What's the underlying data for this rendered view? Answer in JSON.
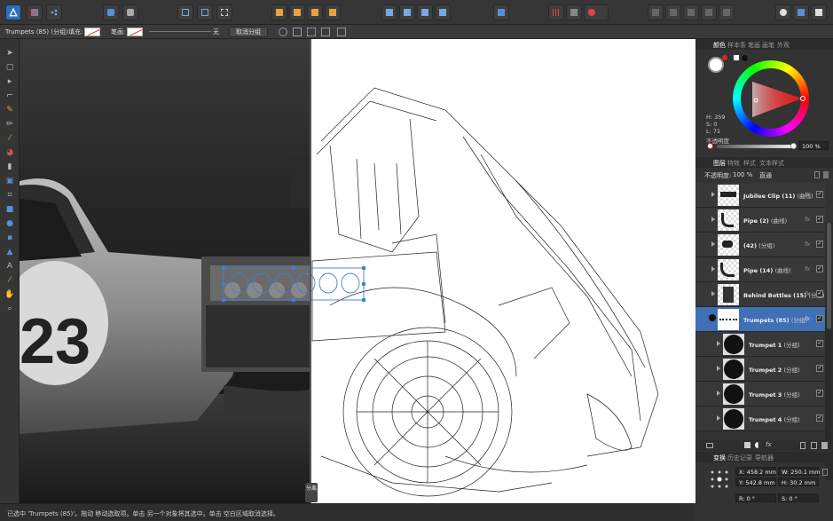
{
  "context_bar": {
    "selection": "Trumpets (85) (分组)",
    "fill_label": "填充:",
    "stroke_label": "笔画:",
    "stroke_width": "无",
    "ungroup_button": "取消分组"
  },
  "canvas": {
    "split_label": "分离",
    "car_number": "23"
  },
  "status": {
    "text": "已选中 'Trumpets (85)'。拖动 移动选取项。单击 另一个对象将其选中。单击 空白区域取消选择。"
  },
  "color_panel": {
    "tabs": [
      "颜色",
      "样本条",
      "笔画",
      "画笔",
      "外观"
    ],
    "active_tab": "颜色",
    "h": "H: 359",
    "s": "S: 0",
    "l": "L: 71",
    "opacity_label": "不透明度",
    "opacity_value": "100 %"
  },
  "layers_panel": {
    "tabs": [
      "图层",
      "特效",
      "样式",
      "文本样式"
    ],
    "active_tab": "图层",
    "opacity_label": "不透明度:",
    "opacity_value": "100 %",
    "blend_mode": "直通",
    "layers": [
      {
        "name": "Jubilee Clip (11)",
        "type": "(曲线)",
        "fx": "fx",
        "checked": "✓",
        "indent": 0
      },
      {
        "name": "Pipe (2)",
        "type": "(曲线)",
        "fx": "fx",
        "checked": "✓",
        "indent": 0
      },
      {
        "name": "(42)",
        "type": "(分组)",
        "fx": "fx",
        "checked": "✓",
        "indent": 0
      },
      {
        "name": "Pipe (14)",
        "type": "(曲线)",
        "fx": "fx",
        "checked": "✓",
        "indent": 0
      },
      {
        "name": "Behind Bottles (15)",
        "type": "(分组)",
        "fx": "fx",
        "checked": "✓",
        "indent": 0
      },
      {
        "name": "Trumpets (85)",
        "type": "(分组)",
        "fx": "fx",
        "checked": "✓",
        "indent": 0,
        "selected": true
      },
      {
        "name": "Trumpet 1",
        "type": "(分组)",
        "fx": "",
        "checked": "✓",
        "indent": 1
      },
      {
        "name": "Trumpet 2",
        "type": "(分组)",
        "fx": "",
        "checked": "✓",
        "indent": 1
      },
      {
        "name": "Trumpet 3",
        "type": "(分组)",
        "fx": "",
        "checked": "✓",
        "indent": 1
      },
      {
        "name": "Trumpet 4",
        "type": "(分组)",
        "fx": "",
        "checked": "✓",
        "indent": 1
      }
    ]
  },
  "transform_panel": {
    "tabs": [
      "变换",
      "历史记录",
      "导航器"
    ],
    "active_tab": "变换",
    "x": "X: 458.2 mm",
    "y": "Y: 542.8 mm",
    "w": "W: 250.1 mm",
    "h": "H: 30.2 mm",
    "r": "R: 0 °",
    "s": "S: 0 °"
  },
  "colors": {
    "accent": "#3f6fb5",
    "panel_bg": "#333333",
    "selected_red": "#e02020"
  }
}
